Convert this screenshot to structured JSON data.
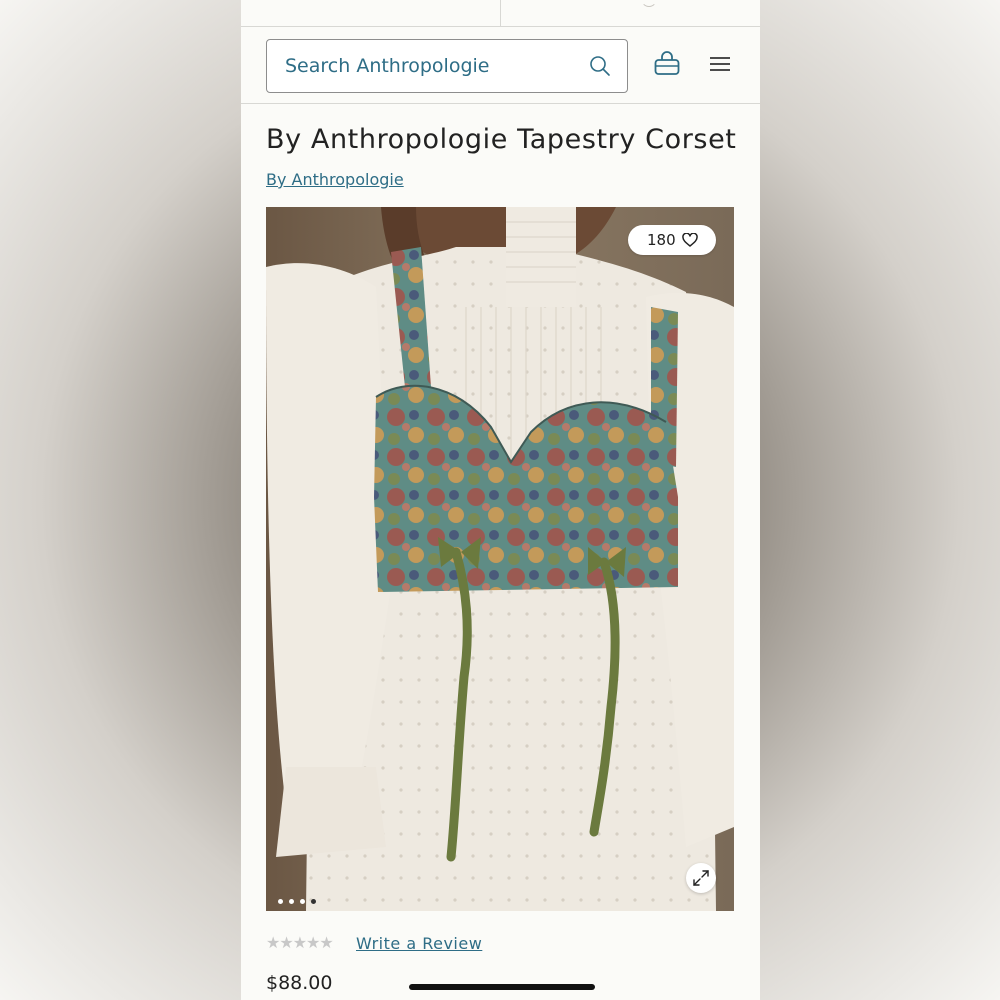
{
  "search": {
    "placeholder": "Search Anthropologie"
  },
  "header": {
    "search_icon": "search-icon",
    "bag_icon": "shopping-bag-icon",
    "menu_icon": "hamburger-menu-icon"
  },
  "product": {
    "title": "By Anthropologie Tapestry Corset",
    "brand": "By Anthropologie",
    "likes": "180",
    "rating_stars": "★★★★★",
    "rating": 0,
    "review_label": "Write a Review",
    "price": "$88.00"
  },
  "gallery": {
    "images": 4,
    "active_index": 3
  },
  "colors": {
    "link": "#2e6d86",
    "text": "#222222"
  }
}
